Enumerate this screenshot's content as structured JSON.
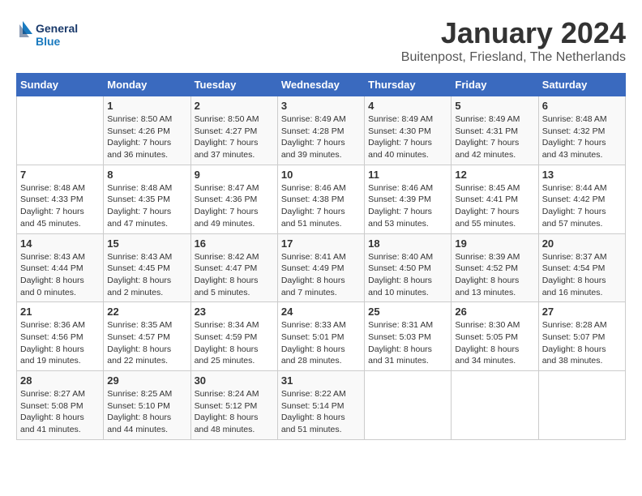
{
  "header": {
    "logo_line1": "General",
    "logo_line2": "Blue",
    "title": "January 2024",
    "subtitle": "Buitenpost, Friesland, The Netherlands"
  },
  "calendar": {
    "days_of_week": [
      "Sunday",
      "Monday",
      "Tuesday",
      "Wednesday",
      "Thursday",
      "Friday",
      "Saturday"
    ],
    "weeks": [
      [
        {
          "day": "",
          "info": ""
        },
        {
          "day": "1",
          "info": "Sunrise: 8:50 AM\nSunset: 4:26 PM\nDaylight: 7 hours\nand 36 minutes."
        },
        {
          "day": "2",
          "info": "Sunrise: 8:50 AM\nSunset: 4:27 PM\nDaylight: 7 hours\nand 37 minutes."
        },
        {
          "day": "3",
          "info": "Sunrise: 8:49 AM\nSunset: 4:28 PM\nDaylight: 7 hours\nand 39 minutes."
        },
        {
          "day": "4",
          "info": "Sunrise: 8:49 AM\nSunset: 4:30 PM\nDaylight: 7 hours\nand 40 minutes."
        },
        {
          "day": "5",
          "info": "Sunrise: 8:49 AM\nSunset: 4:31 PM\nDaylight: 7 hours\nand 42 minutes."
        },
        {
          "day": "6",
          "info": "Sunrise: 8:48 AM\nSunset: 4:32 PM\nDaylight: 7 hours\nand 43 minutes."
        }
      ],
      [
        {
          "day": "7",
          "info": "Sunrise: 8:48 AM\nSunset: 4:33 PM\nDaylight: 7 hours\nand 45 minutes."
        },
        {
          "day": "8",
          "info": "Sunrise: 8:48 AM\nSunset: 4:35 PM\nDaylight: 7 hours\nand 47 minutes."
        },
        {
          "day": "9",
          "info": "Sunrise: 8:47 AM\nSunset: 4:36 PM\nDaylight: 7 hours\nand 49 minutes."
        },
        {
          "day": "10",
          "info": "Sunrise: 8:46 AM\nSunset: 4:38 PM\nDaylight: 7 hours\nand 51 minutes."
        },
        {
          "day": "11",
          "info": "Sunrise: 8:46 AM\nSunset: 4:39 PM\nDaylight: 7 hours\nand 53 minutes."
        },
        {
          "day": "12",
          "info": "Sunrise: 8:45 AM\nSunset: 4:41 PM\nDaylight: 7 hours\nand 55 minutes."
        },
        {
          "day": "13",
          "info": "Sunrise: 8:44 AM\nSunset: 4:42 PM\nDaylight: 7 hours\nand 57 minutes."
        }
      ],
      [
        {
          "day": "14",
          "info": "Sunrise: 8:43 AM\nSunset: 4:44 PM\nDaylight: 8 hours\nand 0 minutes."
        },
        {
          "day": "15",
          "info": "Sunrise: 8:43 AM\nSunset: 4:45 PM\nDaylight: 8 hours\nand 2 minutes."
        },
        {
          "day": "16",
          "info": "Sunrise: 8:42 AM\nSunset: 4:47 PM\nDaylight: 8 hours\nand 5 minutes."
        },
        {
          "day": "17",
          "info": "Sunrise: 8:41 AM\nSunset: 4:49 PM\nDaylight: 8 hours\nand 7 minutes."
        },
        {
          "day": "18",
          "info": "Sunrise: 8:40 AM\nSunset: 4:50 PM\nDaylight: 8 hours\nand 10 minutes."
        },
        {
          "day": "19",
          "info": "Sunrise: 8:39 AM\nSunset: 4:52 PM\nDaylight: 8 hours\nand 13 minutes."
        },
        {
          "day": "20",
          "info": "Sunrise: 8:37 AM\nSunset: 4:54 PM\nDaylight: 8 hours\nand 16 minutes."
        }
      ],
      [
        {
          "day": "21",
          "info": "Sunrise: 8:36 AM\nSunset: 4:56 PM\nDaylight: 8 hours\nand 19 minutes."
        },
        {
          "day": "22",
          "info": "Sunrise: 8:35 AM\nSunset: 4:57 PM\nDaylight: 8 hours\nand 22 minutes."
        },
        {
          "day": "23",
          "info": "Sunrise: 8:34 AM\nSunset: 4:59 PM\nDaylight: 8 hours\nand 25 minutes."
        },
        {
          "day": "24",
          "info": "Sunrise: 8:33 AM\nSunset: 5:01 PM\nDaylight: 8 hours\nand 28 minutes."
        },
        {
          "day": "25",
          "info": "Sunrise: 8:31 AM\nSunset: 5:03 PM\nDaylight: 8 hours\nand 31 minutes."
        },
        {
          "day": "26",
          "info": "Sunrise: 8:30 AM\nSunset: 5:05 PM\nDaylight: 8 hours\nand 34 minutes."
        },
        {
          "day": "27",
          "info": "Sunrise: 8:28 AM\nSunset: 5:07 PM\nDaylight: 8 hours\nand 38 minutes."
        }
      ],
      [
        {
          "day": "28",
          "info": "Sunrise: 8:27 AM\nSunset: 5:08 PM\nDaylight: 8 hours\nand 41 minutes."
        },
        {
          "day": "29",
          "info": "Sunrise: 8:25 AM\nSunset: 5:10 PM\nDaylight: 8 hours\nand 44 minutes."
        },
        {
          "day": "30",
          "info": "Sunrise: 8:24 AM\nSunset: 5:12 PM\nDaylight: 8 hours\nand 48 minutes."
        },
        {
          "day": "31",
          "info": "Sunrise: 8:22 AM\nSunset: 5:14 PM\nDaylight: 8 hours\nand 51 minutes."
        },
        {
          "day": "",
          "info": ""
        },
        {
          "day": "",
          "info": ""
        },
        {
          "day": "",
          "info": ""
        }
      ]
    ]
  }
}
